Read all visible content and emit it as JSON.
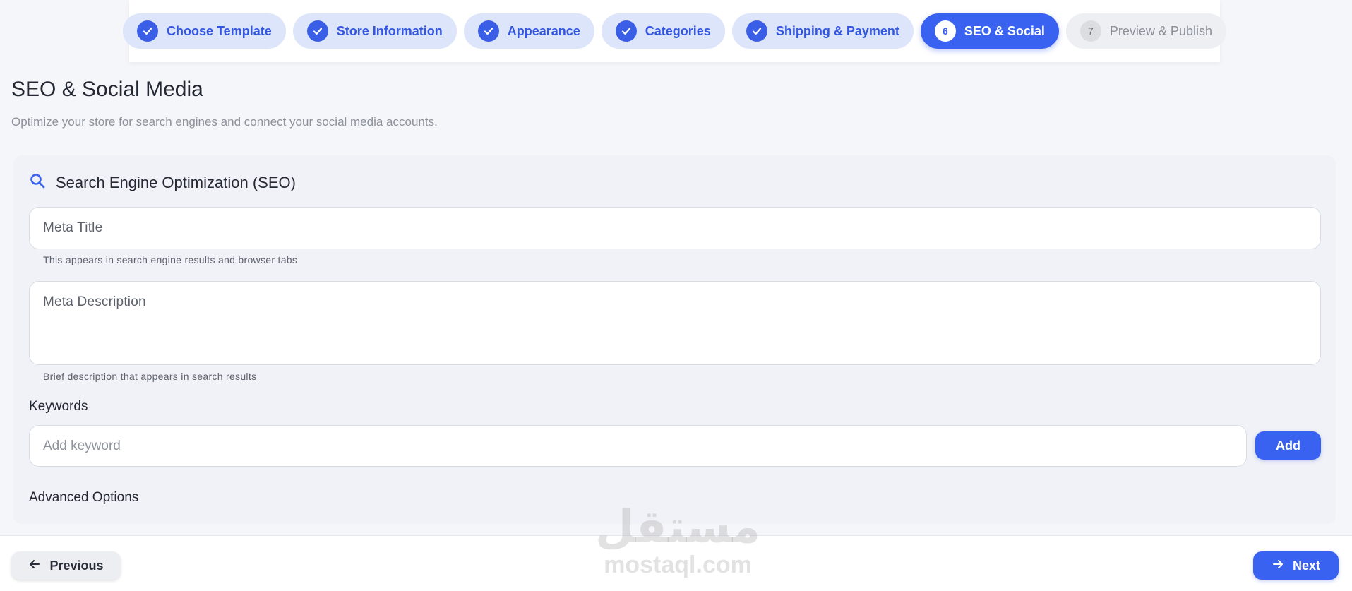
{
  "stepper": {
    "steps": [
      {
        "label": "Choose Template",
        "state": "done"
      },
      {
        "label": "Store Information",
        "state": "done"
      },
      {
        "label": "Appearance",
        "state": "done"
      },
      {
        "label": "Categories",
        "state": "done"
      },
      {
        "label": "Shipping & Payment",
        "state": "done"
      },
      {
        "label": "SEO & Social",
        "state": "active",
        "number": "6"
      },
      {
        "label": "Preview & Publish",
        "state": "pending",
        "number": "7"
      }
    ]
  },
  "header": {
    "title": "SEO & Social Media",
    "subtitle": "Optimize your store for search engines and connect your social media accounts."
  },
  "seo": {
    "section_title": "Search Engine Optimization (SEO)",
    "section_icon": "search-icon",
    "meta_title_label": "Meta Title",
    "meta_title_helper": "This appears in search engine results and browser tabs",
    "meta_description_label": "Meta Description",
    "meta_description_helper": "Brief description that appears in search results",
    "keywords_label": "Keywords",
    "keyword_placeholder": "Add keyword",
    "add_label": "Add",
    "advanced_label": "Advanced Options"
  },
  "footer": {
    "previous_label": "Previous",
    "next_label": "Next"
  },
  "watermark": {
    "arabic": "مستقل",
    "latin": "mostaql.com"
  },
  "colors": {
    "accent": "#3a62f0",
    "step_done_bg": "#dde5fb",
    "step_pending_bg": "#eeeff2",
    "page_bg": "#f5f6fa"
  }
}
